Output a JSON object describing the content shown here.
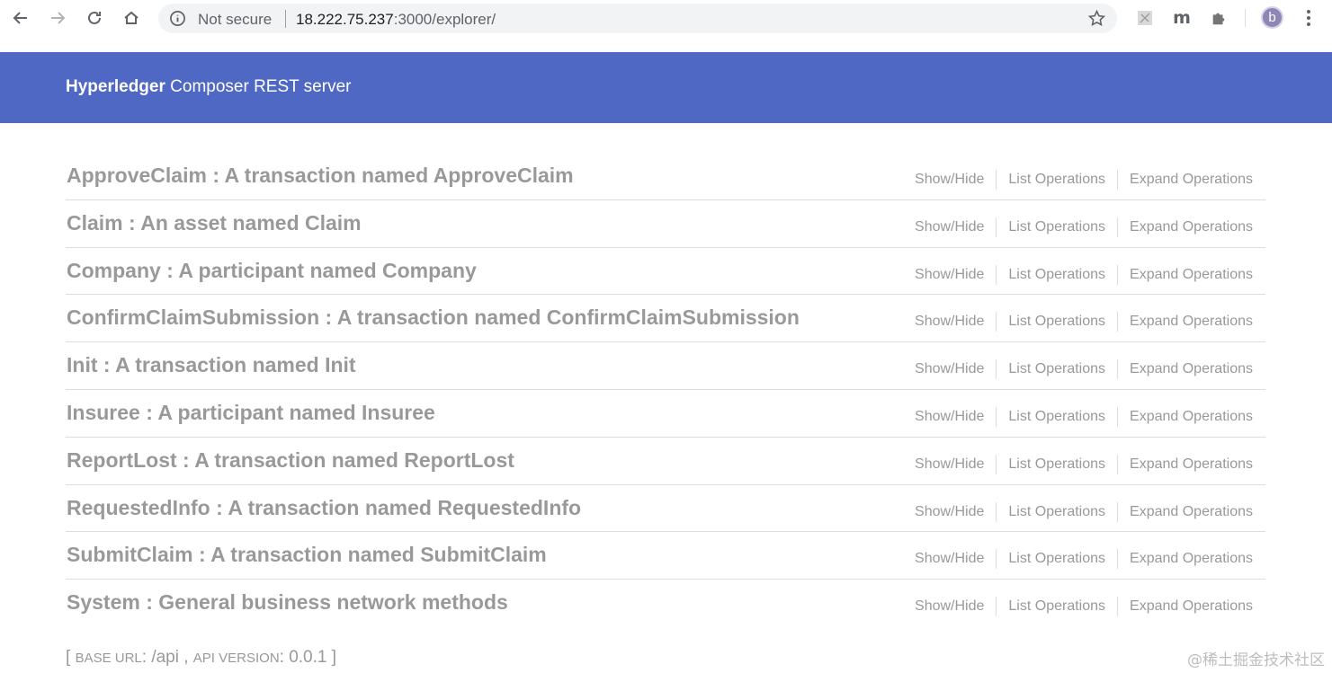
{
  "browser": {
    "not_secure_label": "Not secure",
    "url_host": "18.222.75.237",
    "url_path": ":3000/explorer/",
    "avatar_letter": "b",
    "extension_m_label": "m"
  },
  "header": {
    "title_bold": "Hyperledger",
    "title_rest": " Composer REST server"
  },
  "resources": [
    {
      "title": "ApproveClaim : A transaction named ApproveClaim",
      "show_hide": "Show/Hide",
      "list_ops": "List Operations",
      "expand_ops": "Expand Operations"
    },
    {
      "title": "Claim : An asset named Claim",
      "show_hide": "Show/Hide",
      "list_ops": "List Operations",
      "expand_ops": "Expand Operations"
    },
    {
      "title": "Company : A participant named Company",
      "show_hide": "Show/Hide",
      "list_ops": "List Operations",
      "expand_ops": "Expand Operations"
    },
    {
      "title": "ConfirmClaimSubmission : A transaction named ConfirmClaimSubmission",
      "show_hide": "Show/Hide",
      "list_ops": "List Operations",
      "expand_ops": "Expand Operations"
    },
    {
      "title": "Init : A transaction named Init",
      "show_hide": "Show/Hide",
      "list_ops": "List Operations",
      "expand_ops": "Expand Operations"
    },
    {
      "title": "Insuree : A participant named Insuree",
      "show_hide": "Show/Hide",
      "list_ops": "List Operations",
      "expand_ops": "Expand Operations"
    },
    {
      "title": "ReportLost : A transaction named ReportLost",
      "show_hide": "Show/Hide",
      "list_ops": "List Operations",
      "expand_ops": "Expand Operations"
    },
    {
      "title": "RequestedInfo : A transaction named RequestedInfo",
      "show_hide": "Show/Hide",
      "list_ops": "List Operations",
      "expand_ops": "Expand Operations"
    },
    {
      "title": "SubmitClaim : A transaction named SubmitClaim",
      "show_hide": "Show/Hide",
      "list_ops": "List Operations",
      "expand_ops": "Expand Operations"
    },
    {
      "title": "System : General business network methods",
      "show_hide": "Show/Hide",
      "list_ops": "List Operations",
      "expand_ops": "Expand Operations"
    }
  ],
  "footer": {
    "open_bracket": "[ ",
    "base_url_label": "Base URL",
    "base_url_value": ": /api , ",
    "api_version_label": "Api Version",
    "api_version_value": ": 0.0.1 ]"
  },
  "watermark": "@稀土掘金技术社区",
  "colors": {
    "header_bg": "#4f68c4",
    "text_muted": "#999999",
    "divider": "#dddddd"
  },
  "icons": [
    "back-arrow-icon",
    "forward-arrow-icon",
    "reload-icon",
    "home-icon",
    "info-icon",
    "star-icon",
    "extension-icon",
    "menu-dots-icon"
  ]
}
